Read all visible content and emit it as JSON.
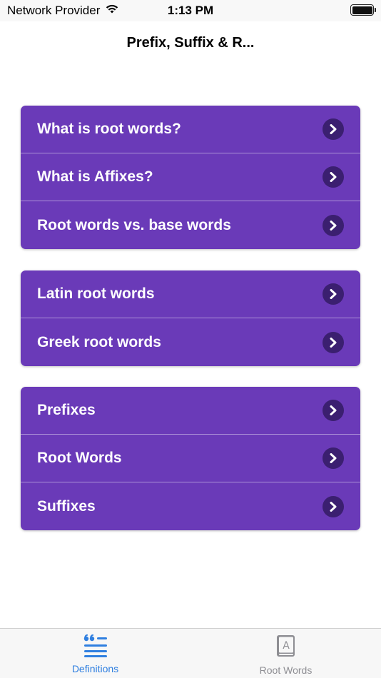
{
  "status_bar": {
    "carrier": "Network Provider",
    "time": "1:13 PM",
    "wifi_icon": "wifi-icon",
    "battery_icon": "battery-icon"
  },
  "nav": {
    "title": "Prefix, Suffix & R..."
  },
  "groups": [
    {
      "rows": [
        {
          "label": "What is root words?",
          "icon": "chevron-right-icon"
        },
        {
          "label": "What is Affixes?",
          "icon": "chevron-right-icon"
        },
        {
          "label": "Root words vs. base words",
          "icon": "chevron-right-icon"
        }
      ]
    },
    {
      "rows": [
        {
          "label": "Latin root words",
          "icon": "chevron-right-icon"
        },
        {
          "label": "Greek root words",
          "icon": "chevron-right-icon"
        }
      ]
    },
    {
      "rows": [
        {
          "label": "Prefixes",
          "icon": "chevron-right-icon"
        },
        {
          "label": "Root Words",
          "icon": "chevron-right-icon"
        },
        {
          "label": "Suffixes",
          "icon": "chevron-right-icon"
        }
      ]
    }
  ],
  "tabs": [
    {
      "label": "Definitions",
      "icon": "quote-list-icon",
      "active": true
    },
    {
      "label": "Root Words",
      "icon": "book-icon",
      "active": false
    }
  ],
  "colors": {
    "row_background": "#6a3ab8",
    "chevron_circle": "#3b1f70",
    "tab_active": "#2f7fe0",
    "tab_inactive": "#8e8e93"
  }
}
